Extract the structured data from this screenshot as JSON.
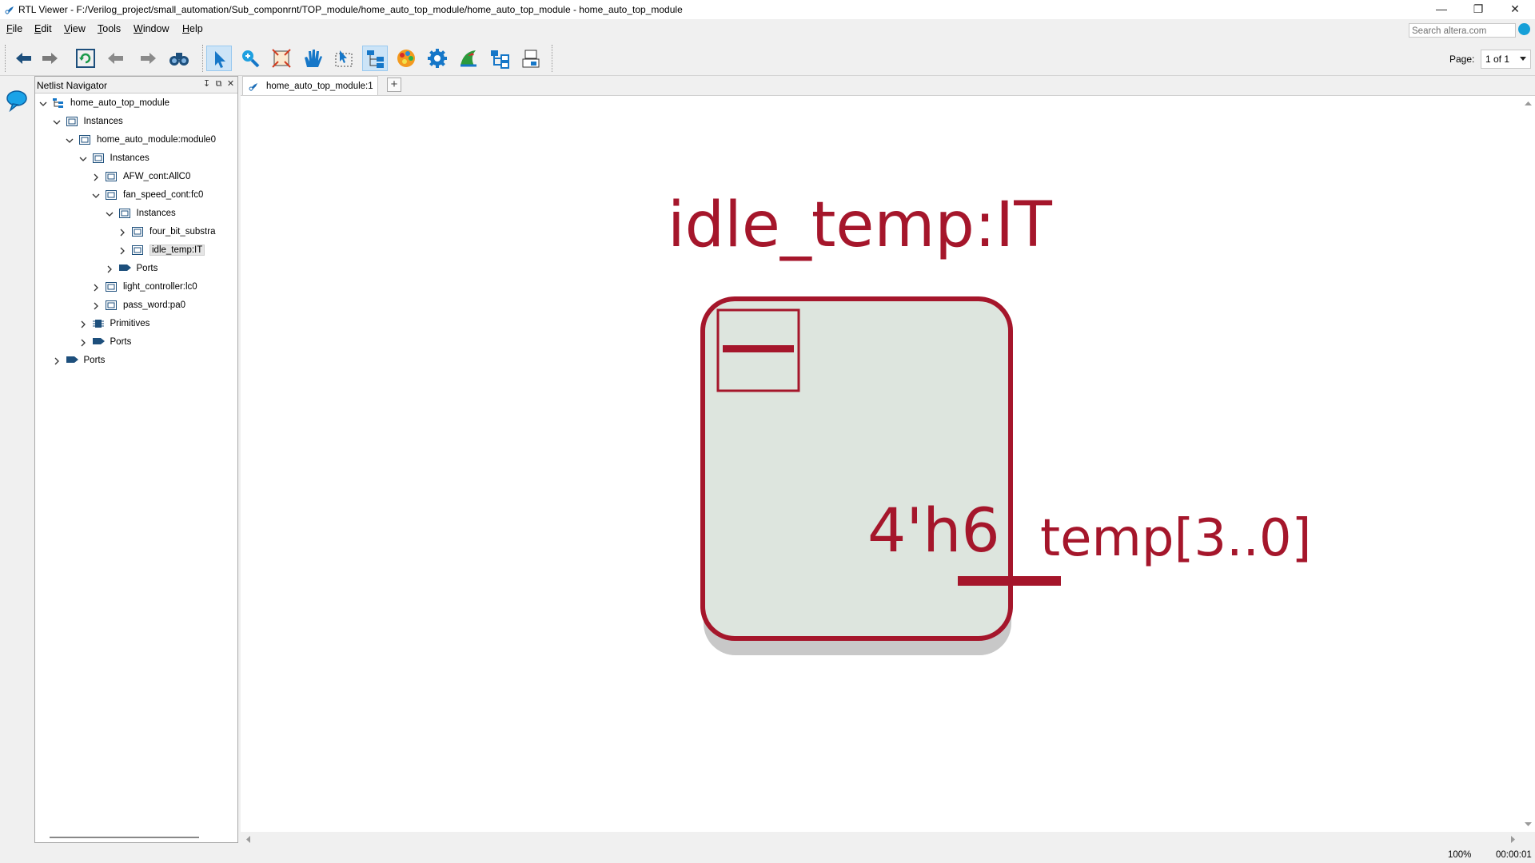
{
  "window": {
    "title": "RTL Viewer - F:/Verilog_project/small_automation/Sub_componrnt/TOP_module/home_auto_top_module/home_auto_top_module - home_auto_top_module",
    "controls": [
      "minimize-icon",
      "restore-icon",
      "close-icon"
    ]
  },
  "menu": {
    "items": [
      "File",
      "Edit",
      "View",
      "Tools",
      "Window",
      "Help"
    ]
  },
  "search": {
    "placeholder": "Search altera.com"
  },
  "toolbar": {
    "buttons": [
      "back-icon",
      "forward-icon",
      "refresh-icon",
      "previous-icon",
      "next-icon",
      "find-icon",
      "selection-tool-icon",
      "zoom-tool-icon",
      "fit-icon",
      "hand-tool-icon",
      "area-select-icon",
      "hierarchy-icon",
      "netlist-color-icon",
      "settings-icon",
      "techmap-icon",
      "export-icon",
      "filter-icon"
    ],
    "active_buttons": [
      "selection-tool-icon",
      "hierarchy-icon"
    ],
    "page_label": "Page:",
    "page_value": "1 of 1"
  },
  "navigator": {
    "title": "Netlist Navigator",
    "tree": [
      {
        "label": "home_auto_top_module",
        "level": 0,
        "expanded": true,
        "icon": "hierarchy-icon"
      },
      {
        "label": "Instances",
        "level": 1,
        "expanded": true,
        "icon": "instance-icon"
      },
      {
        "label": "home_auto_module:module0",
        "level": 2,
        "expanded": true,
        "icon": "instance-icon"
      },
      {
        "label": "Instances",
        "level": 3,
        "expanded": true,
        "icon": "instance-icon"
      },
      {
        "label": "AFW_cont:AllC0",
        "level": 4,
        "expanded": false,
        "icon": "instance-icon"
      },
      {
        "label": "fan_speed_cont:fc0",
        "level": 4,
        "expanded": true,
        "icon": "instance-icon"
      },
      {
        "label": "Instances",
        "level": 5,
        "expanded": true,
        "icon": "instance-icon"
      },
      {
        "label": "four_bit_substra",
        "level": 6,
        "expanded": false,
        "icon": "instance-icon"
      },
      {
        "label": "idle_temp:IT",
        "level": 6,
        "expanded": false,
        "icon": "instance-icon",
        "selected": true
      },
      {
        "label": "Ports",
        "level": 5,
        "expanded": false,
        "icon": "port-icon"
      },
      {
        "label": "light_controller:lc0",
        "level": 4,
        "expanded": false,
        "icon": "instance-icon"
      },
      {
        "label": "pass_word:pa0",
        "level": 4,
        "expanded": false,
        "icon": "instance-icon"
      },
      {
        "label": "Primitives",
        "level": 3,
        "expanded": false,
        "icon": "primitive-icon"
      },
      {
        "label": "Ports",
        "level": 3,
        "expanded": false,
        "icon": "port-icon"
      },
      {
        "label": "Ports",
        "level": 1,
        "expanded": false,
        "icon": "port-icon"
      }
    ]
  },
  "tabs": [
    {
      "label": "home_auto_top_module:1",
      "active": true
    }
  ],
  "schematic": {
    "instance_name": "idle_temp:IT",
    "constant": "4'h6",
    "port_label": "temp[3..0]",
    "color": "#a5162b",
    "fill": "#dde5de",
    "shadow": "#c8c8c8"
  },
  "status": {
    "zoom": "100%",
    "time": "00:00:01"
  }
}
